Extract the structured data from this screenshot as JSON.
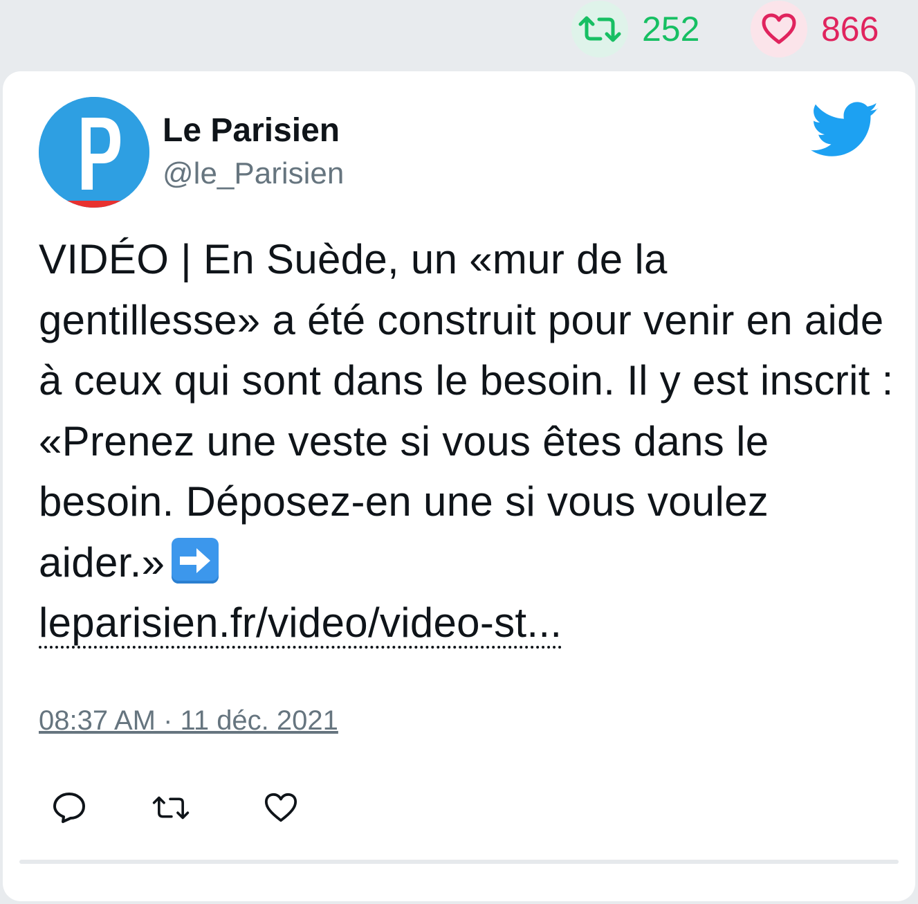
{
  "top_stats": {
    "retweets": "252",
    "likes": "866",
    "retweet_icon": "retweet-icon",
    "like_icon": "heart-icon"
  },
  "tweet": {
    "author_name": "Le Parisien",
    "author_handle": "@le_Parisien",
    "text": "VIDÉO | En Suède, un «mur de la gentillesse» a été construit pour venir en aide à ceux qui sont dans le besoin. Il y est inscrit : «Prenez une veste si vous êtes dans le besoin. Déposez-en une si vous voulez aider.»",
    "link_text": "leparisien.fr/video/video-st...",
    "timestamp": "08:37 AM · 11 déc. 2021"
  },
  "actions": [
    "reply-icon",
    "retweet-icon",
    "heart-icon"
  ],
  "colors": {
    "retweet": "#17bf63",
    "like": "#e0245e",
    "twitter_blue": "#1da1f2",
    "handle_gray": "#66757f"
  }
}
